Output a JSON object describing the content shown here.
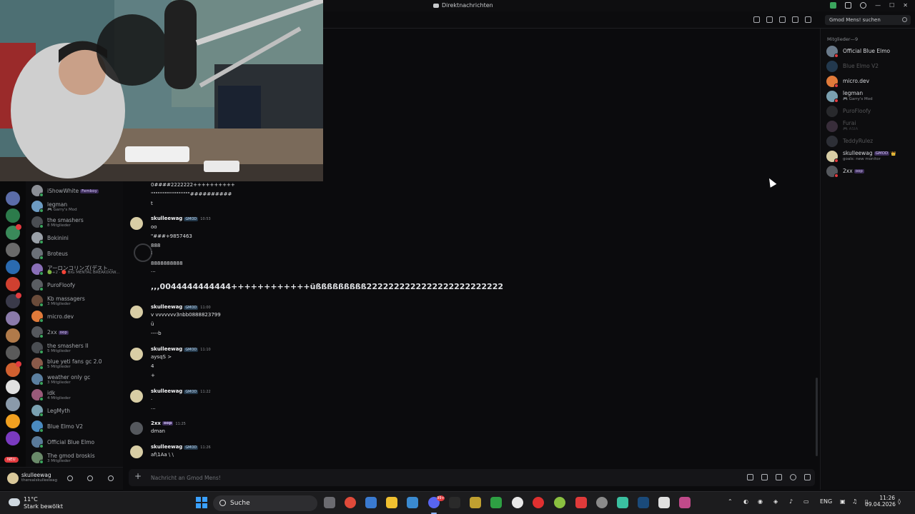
{
  "window": {
    "title": "Direktnachrichten"
  },
  "header": {
    "search_placeholder": "Gmod Mens! suchen"
  },
  "dm_list": [
    {
      "name": "iShowWhite",
      "tag": "Femboy",
      "sub": "",
      "color": "#8c8f96"
    },
    {
      "name": "legman",
      "tag": "",
      "sub": "🎮 Garry's Mod",
      "color": "#6d9bc3"
    },
    {
      "name": "the smashers",
      "tag": "",
      "sub": "8 Mitglieder",
      "color": "#4a4d52"
    },
    {
      "name": "Bokinini",
      "tag": "",
      "sub": "",
      "color": "#9aa0a8"
    },
    {
      "name": "Broteus",
      "tag": "",
      "sub": "",
      "color": "#6b7078"
    },
    {
      "name": "アーロンコリンズ(デスト...",
      "tag": "",
      "sub": "🟢+2 · 🔴 BIG MENTAL BREAKDOW...",
      "color": "#8a6fb8"
    },
    {
      "name": "PuroFloofy",
      "tag": "",
      "sub": "",
      "color": "#5a5d62"
    },
    {
      "name": "Kb massagers",
      "tag": "",
      "sub": "3 Mitglieder",
      "color": "#6a4b3a"
    },
    {
      "name": "micro.dev",
      "tag": "",
      "sub": "",
      "color": "#e07a3a"
    },
    {
      "name": "2xx",
      "tag": "oop",
      "sub": "",
      "color": "#55585d"
    },
    {
      "name": "the smashers II",
      "tag": "",
      "sub": "5 Mitglieder",
      "color": "#4a4d52"
    },
    {
      "name": "blue yeti fans gc 2.0",
      "tag": "",
      "sub": "5 Mitglieder",
      "color": "#8a5a4a"
    },
    {
      "name": "weather only gc",
      "tag": "",
      "sub": "3 Mitglieder",
      "color": "#5b7fa0"
    },
    {
      "name": "idk",
      "tag": "",
      "sub": "4 Mitglieder",
      "color": "#9a5a7a"
    },
    {
      "name": "LegMyth",
      "tag": "",
      "sub": "",
      "color": "#7aa0b0"
    },
    {
      "name": "Blue Elmo V2",
      "tag": "",
      "sub": "",
      "color": "#4a8ac0"
    },
    {
      "name": "Official Blue Elmo",
      "tag": "",
      "sub": "",
      "color": "#5a7a9a"
    },
    {
      "name": "The gmod broskis",
      "tag": "",
      "sub": "3 Mitglieder",
      "color": "#6a8a6a"
    }
  ],
  "user_panel": {
    "name": "skulleewag",
    "status": "therealskulleewag"
  },
  "new_badge": "NEU",
  "messages": {
    "top_lines": [
      "0####2222222++++++++++",
      "\"\"\"\"\"\"\"\"\"\"\"\"\"\"\"\"\"##########",
      "t"
    ],
    "m1": {
      "author": "skulleewag",
      "tag": "GMOD",
      "time": "10:53",
      "lines": [
        "oo",
        "\"###+9857463",
        "888",
        ":",
        "8888888888",
        "..."
      ]
    },
    "big_line": ",,,0044444444444++++++++++++üßßßßßßßßß2222222222222222222222222",
    "m2": {
      "author": "skulleewag",
      "tag": "GMOD",
      "time": "11:00",
      "lines": [
        "v vvvvvvv3nbb0888823799",
        "ü",
        "----b"
      ]
    },
    "m3": {
      "author": "skulleewag",
      "tag": "GMOD",
      "time": "11:10",
      "lines": [
        "aysqS   >",
        "4",
        "+"
      ]
    },
    "m4": {
      "author": "skulleewag",
      "tag": "GMOD",
      "time": "11:22",
      "lines": [
        ".",
        "..."
      ]
    },
    "m5": {
      "author": "2xx",
      "tag": "oop",
      "time": "11:25",
      "lines": [
        "dman"
      ]
    },
    "m6": {
      "author": "skulleewag",
      "tag": "GMOD",
      "time": "11:26",
      "lines": [
        "af\\1Aa \\ \\"
      ]
    }
  },
  "composer": {
    "placeholder": "Nachricht an Gmod Mens!"
  },
  "members": {
    "header": "Mitglieder—9",
    "list": [
      {
        "name": "Official Blue Elmo",
        "sub": "",
        "off": false,
        "color": "#6a7a8a"
      },
      {
        "name": "Blue Elmo V2",
        "sub": "",
        "off": true,
        "color": "#4a8ac0"
      },
      {
        "name": "micro.dev",
        "sub": "",
        "off": false,
        "color": "#e07a3a"
      },
      {
        "name": "legman",
        "sub": "🎮 Garry's Mod",
        "off": false,
        "color": "#7aa0b0"
      },
      {
        "name": "PuroFloofy",
        "sub": "",
        "off": true,
        "color": "#5a5d62"
      },
      {
        "name": "Furai",
        "sub": "🎮 ASIA",
        "off": true,
        "color": "#8a6a8a"
      },
      {
        "name": "TeddyRulez",
        "sub": "",
        "off": true,
        "color": "#6a7080"
      },
      {
        "name": "skulleewag",
        "sub": "goals: new monitor",
        "off": false,
        "color": "#d8cda5",
        "tag": "GMOD",
        "crown": "👑"
      },
      {
        "name": "2xx",
        "sub": "",
        "off": false,
        "color": "#55585d",
        "tag": "oop"
      }
    ]
  },
  "taskbar": {
    "weather_temp": "11°C",
    "weather_desc": "Stark bewölkt",
    "search_label": "Suche",
    "lang": "ENG",
    "time": "11:26",
    "date": "09.04.2026",
    "discord_badge": "99+"
  }
}
